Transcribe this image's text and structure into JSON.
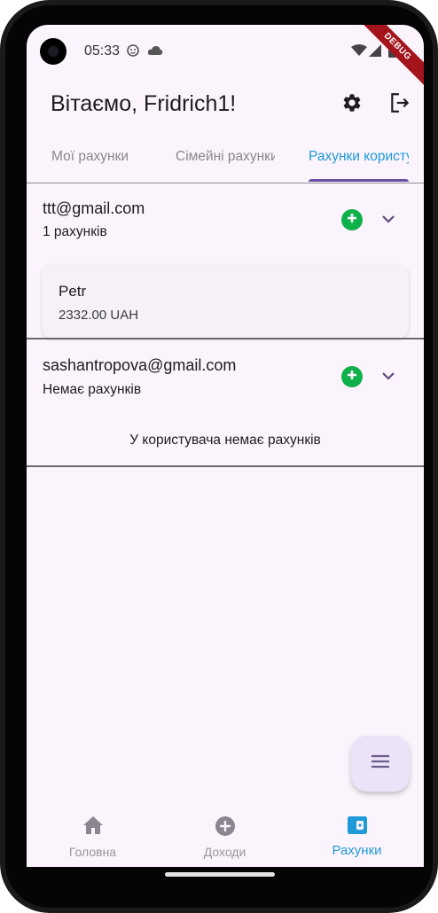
{
  "status_bar": {
    "time": "05:33",
    "debug_label": "DEBUG"
  },
  "header": {
    "greeting": "Вітаємо, Fridrich1!",
    "settings_icon": "gear-icon",
    "logout_icon": "logout-icon"
  },
  "tabs": [
    {
      "label": "Мої рахунки"
    },
    {
      "label": "Сімейні рахунки"
    },
    {
      "label": "Рахунки користувачів"
    }
  ],
  "user_groups": [
    {
      "email": "ttt@gmail.com",
      "subtitle": "1 рахунків",
      "accounts": [
        {
          "name": "Petr",
          "balance": "2332.00 UAH"
        }
      ]
    },
    {
      "email": "sashantropova@gmail.com",
      "subtitle": "Немає рахунків",
      "empty_message": "У користувача немає рахунків"
    }
  ],
  "fab": {
    "icon": "menu-icon"
  },
  "bottom_nav": [
    {
      "label": "Головна",
      "icon": "home-icon"
    },
    {
      "label": "Доходи",
      "icon": "add-circle-icon"
    },
    {
      "label": "Рахунки",
      "icon": "wallet-icon"
    }
  ],
  "colors": {
    "accent": "#1e9ad6",
    "indicator": "#6750a4",
    "add": "#0fb14a",
    "background": "#fcf4fc"
  }
}
